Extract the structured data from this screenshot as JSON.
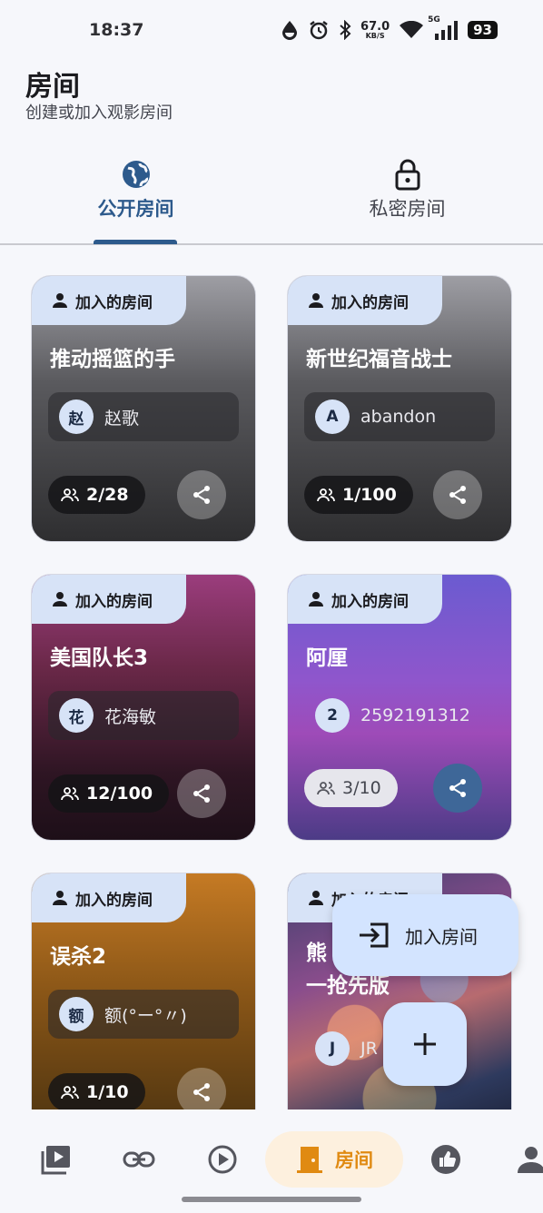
{
  "status_bar": {
    "time": "18:37",
    "net_speed_value": "67.0",
    "net_speed_unit": "KB/S",
    "network_type": "5G",
    "battery": "93",
    "icons": [
      "water-drop-icon",
      "alarm-icon",
      "bluetooth-icon",
      "wifi-icon",
      "signal-icon"
    ]
  },
  "header": {
    "title": "房间",
    "subtitle": "创建或加入观影房间"
  },
  "tabs": [
    {
      "label": "公开房间",
      "icon": "globe-icon",
      "selected": true
    },
    {
      "label": "私密房间",
      "icon": "lock-icon",
      "selected": false
    }
  ],
  "rooms": [
    {
      "tag": "加入的房间",
      "name": "推动摇篮的手",
      "owner_initial": "赵",
      "owner_name": "赵歌",
      "count": "2/28"
    },
    {
      "tag": "加入的房间",
      "name": "新世纪福音战士",
      "owner_initial": "A",
      "owner_name": "abandon",
      "count": "1/100"
    },
    {
      "tag": "加入的房间",
      "name": "美国队长3",
      "owner_initial": "花",
      "owner_name": "花海敏",
      "count": "12/100"
    },
    {
      "tag": "加入的房间",
      "name": "阿厘",
      "owner_initial": "2",
      "owner_name": "2592191312",
      "count": "3/10"
    },
    {
      "tag": "加入的房间",
      "name": "误杀2",
      "owner_initial": "额",
      "owner_name": "额(°ー°〃)",
      "count": "1/10"
    },
    {
      "tag": "加入的房间",
      "name": "熊",
      "name_line2": "一抢先版",
      "owner_initial": "J",
      "owner_name": "JR"
    }
  ],
  "fab": {
    "join_label": "加入房间",
    "join_icon": "login-icon",
    "add_icon": "plus-icon"
  },
  "bottom_nav": {
    "items": [
      {
        "icon": "video-library-icon"
      },
      {
        "icon": "link-icon"
      },
      {
        "icon": "play-circle-icon"
      },
      {
        "icon": "door-icon",
        "label": "房间",
        "active": true
      },
      {
        "icon": "thumb-up-icon"
      },
      {
        "icon": "person-icon"
      }
    ]
  },
  "colors": {
    "accent": "#2d5a8c",
    "active_nav": "#e08a12",
    "tag_bg": "#d7e3f7"
  }
}
